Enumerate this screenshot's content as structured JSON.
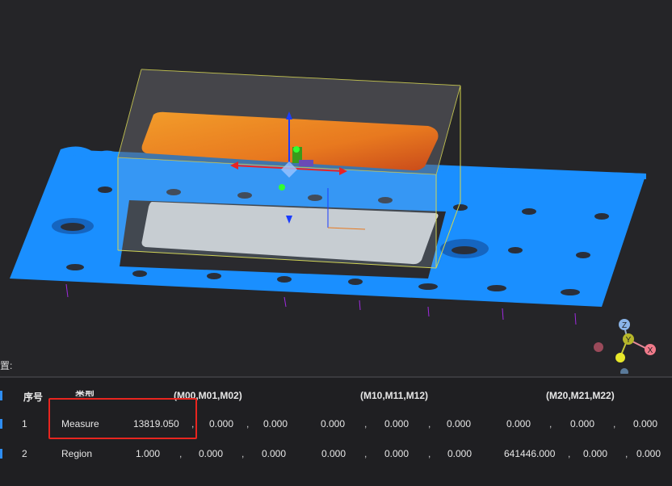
{
  "panel": {
    "label": "置:"
  },
  "table": {
    "headers": {
      "index": "序号",
      "type": "类型",
      "col_m0": "(M00,M01,M02)",
      "col_m1": "(M10,M11,M12)",
      "col_m2": "(M20,M21,M22)"
    },
    "rows": [
      {
        "index": "1",
        "type": "Measure",
        "m00": "13819.050",
        "m01": "0.000",
        "m02": "0.000",
        "m10": "0.000",
        "m11": "0.000",
        "m12": "0.000",
        "m20": "0.000",
        "m21": "0.000",
        "m22": "0.000"
      },
      {
        "index": "2",
        "type": "Region",
        "m00": "1.000",
        "m01": "0.000",
        "m02": "0.000",
        "m10": "0.000",
        "m11": "0.000",
        "m12": "0.000",
        "m20": "641446.000",
        "m21": "0.000",
        "m22": "0.000"
      }
    ],
    "separator": ","
  },
  "axis_gizmo": {
    "x_label": "X",
    "y_label": "Y",
    "z_label": "Z"
  },
  "colors": {
    "plate": "#1a8fff",
    "bbox": "#d8d84a",
    "highlight": "#e8251f",
    "accent": "#2e8df2"
  }
}
